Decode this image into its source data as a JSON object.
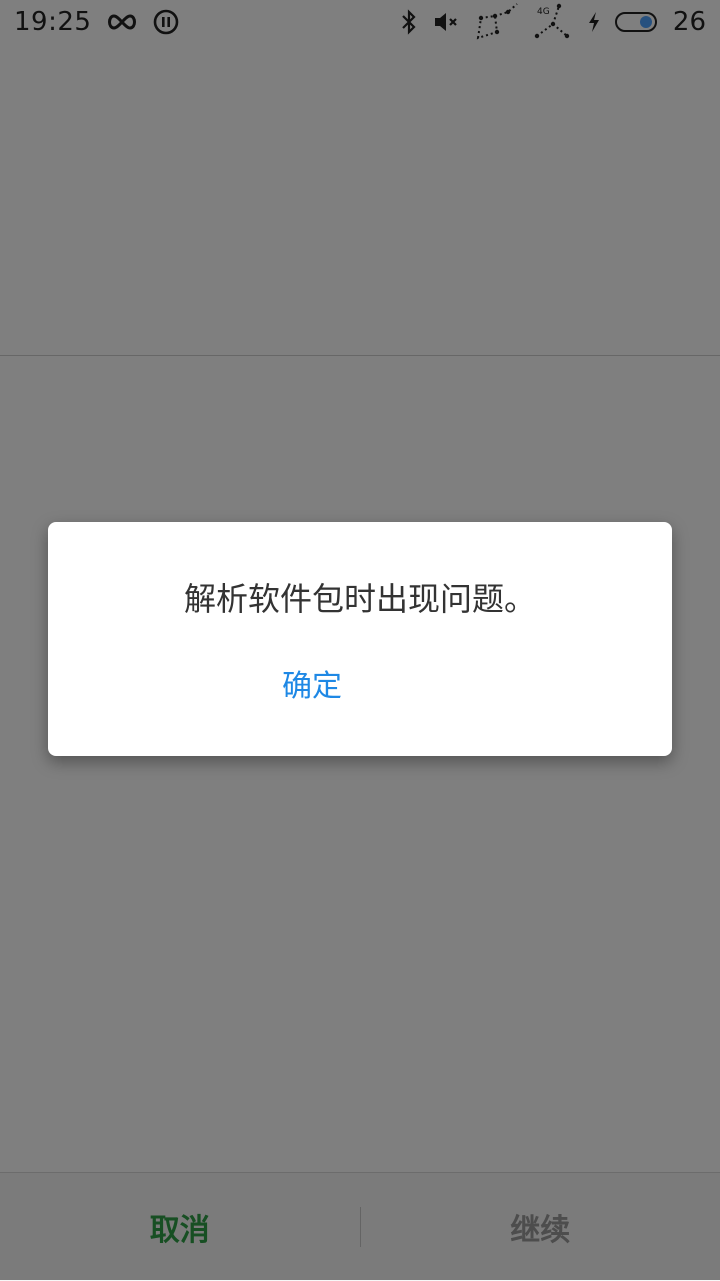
{
  "status_bar": {
    "time": "19:25",
    "battery_level": "26",
    "icons": [
      "infinity-icon",
      "pause-circle-icon",
      "bluetooth-icon",
      "volume-muted-icon",
      "signal-sim1-icon",
      "signal-4g-icon",
      "charging-icon",
      "battery-icon"
    ],
    "network_label": "4G"
  },
  "dialog": {
    "message": "解析软件包时出现问题。",
    "ok_label": "确定"
  },
  "bottom_bar": {
    "cancel_label": "取消",
    "continue_label": "继续"
  },
  "colors": {
    "accent_blue": "#1e88e5",
    "cancel_green": "#2e9e46",
    "disabled_gray": "#9a9a9a",
    "scrim": "rgba(0,0,0,0.5)"
  }
}
